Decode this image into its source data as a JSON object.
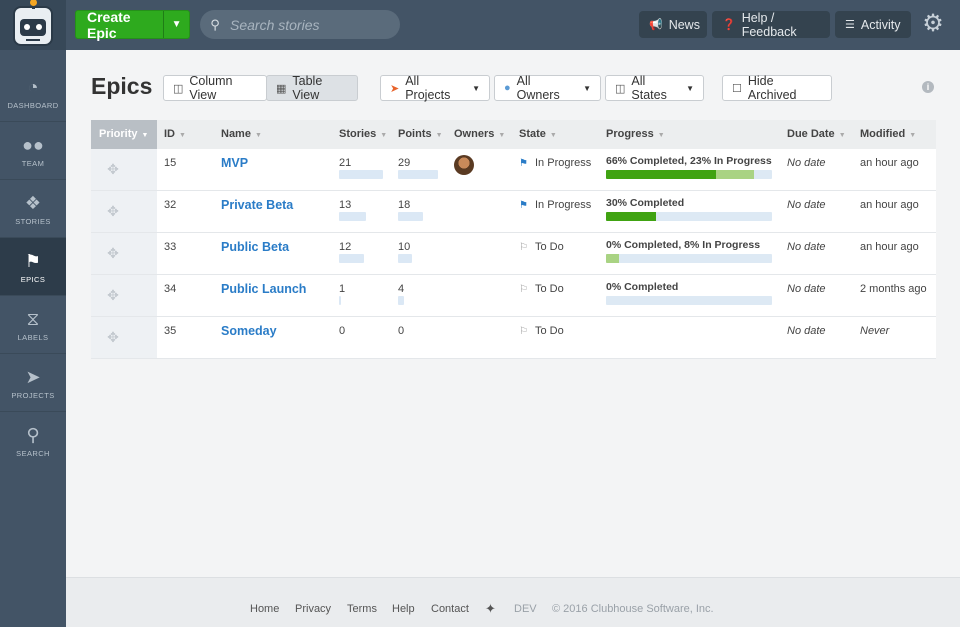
{
  "topbar": {
    "create_label": "Create Epic",
    "search_placeholder": "Search stories",
    "news_label": "News",
    "help_label": "Help / Feedback",
    "activity_label": "Activity"
  },
  "sidebar": {
    "items": [
      {
        "label": "DASHBOARD",
        "icon": "dashboard-icon"
      },
      {
        "label": "TEAM",
        "icon": "team-icon"
      },
      {
        "label": "STORIES",
        "icon": "stories-icon"
      },
      {
        "label": "EPICS",
        "icon": "epics-icon",
        "active": true
      },
      {
        "label": "LABELS",
        "icon": "labels-icon"
      },
      {
        "label": "PROJECTS",
        "icon": "projects-icon"
      },
      {
        "label": "SEARCH",
        "icon": "search-icon"
      }
    ]
  },
  "page": {
    "title": "Epics",
    "column_view": "Column View",
    "table_view": "Table View",
    "all_projects": "All Projects",
    "all_owners": "All Owners",
    "all_states": "All States",
    "hide_archived": "Hide Archived"
  },
  "table": {
    "headers": {
      "priority": "Priority",
      "id": "ID",
      "name": "Name",
      "stories": "Stories",
      "points": "Points",
      "owners": "Owners",
      "state": "State",
      "progress": "Progress",
      "due_date": "Due Date",
      "modified": "Modified"
    },
    "rows": [
      {
        "id": "15",
        "name": "MVP",
        "stories": "21",
        "points": "29",
        "has_owner": true,
        "state": "In Progress",
        "state_kind": "in-progress",
        "progress_label": "66% Completed, 23% In Progress",
        "completed": 66,
        "in_progress": 23,
        "stories_fill": 1.0,
        "points_fill": 1.0,
        "due": "No date",
        "modified": "an hour ago"
      },
      {
        "id": "32",
        "name": "Private Beta",
        "stories": "13",
        "points": "18",
        "has_owner": false,
        "state": "In Progress",
        "state_kind": "in-progress",
        "progress_label": "30% Completed",
        "completed": 30,
        "in_progress": 0,
        "stories_fill": 0.62,
        "points_fill": 0.62,
        "due": "No date",
        "modified": "an hour ago"
      },
      {
        "id": "33",
        "name": "Public Beta",
        "stories": "12",
        "points": "10",
        "has_owner": false,
        "state": "To Do",
        "state_kind": "to-do",
        "progress_label": "0% Completed, 8% In Progress",
        "completed": 0,
        "in_progress": 8,
        "stories_fill": 0.57,
        "points_fill": 0.34,
        "due": "No date",
        "modified": "an hour ago"
      },
      {
        "id": "34",
        "name": "Public Launch",
        "stories": "1",
        "points": "4",
        "has_owner": false,
        "state": "To Do",
        "state_kind": "to-do",
        "progress_label": "0% Completed",
        "completed": 0,
        "in_progress": 0,
        "stories_fill": 0.05,
        "points_fill": 0.14,
        "due": "No date",
        "modified": "2 months ago"
      },
      {
        "id": "35",
        "name": "Someday",
        "stories": "0",
        "points": "0",
        "has_owner": false,
        "state": "To Do",
        "state_kind": "to-do",
        "progress_label": "",
        "completed": null,
        "in_progress": null,
        "stories_fill": 0,
        "points_fill": 0,
        "due": "No date",
        "modified": "Never"
      }
    ]
  },
  "footer": {
    "home": "Home",
    "privacy": "Privacy",
    "terms": "Terms",
    "help": "Help",
    "contact": "Contact",
    "dev": "DEV",
    "copyright": "© 2016 Clubhouse Software, Inc."
  },
  "colors": {
    "topbar": "#435466",
    "create": "#2eaa1e",
    "link": "#2a7cc7",
    "progress_done": "#40a312",
    "progress_in_progress": "#a9d383"
  }
}
